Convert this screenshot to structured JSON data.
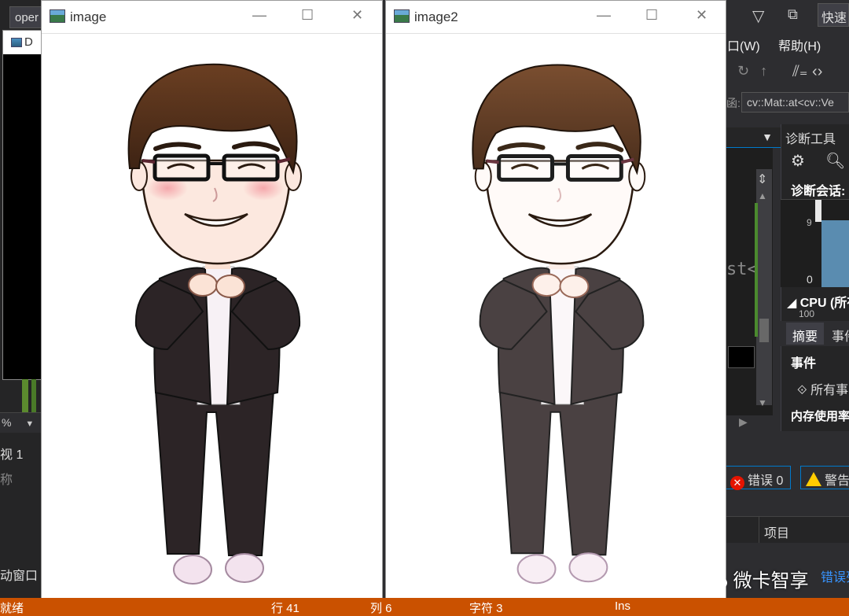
{
  "ide": {
    "console_tab": "oper",
    "console_title": "D",
    "menu_window": "口(W)",
    "menu_help": "帮助(H)",
    "quick_launch": "快速",
    "function_prefix": "函:",
    "function_combo": "cv::Mat::at<cv::Ve",
    "code_fragment": "st<",
    "zoom": "%",
    "left_panel_line1": "视 1",
    "left_panel_line2": "称",
    "left_bottom_label": "动窗口"
  },
  "diagnostics": {
    "title": "诊断工具",
    "session_label": "诊断会话:",
    "axis_top": "9",
    "axis_zero": "0",
    "cpu_label": "◢ CPU (所有",
    "axis_100": "100",
    "tab_summary": "摘要",
    "tab_events": "事件",
    "events_header": "事件",
    "all_events": "所有事",
    "memory_usage": "内存使用率"
  },
  "error_list": {
    "errors": "错误 0",
    "warnings": "警告",
    "column_project": "项目",
    "link": "错误列"
  },
  "windows": [
    {
      "title": "image"
    },
    {
      "title": "image2"
    }
  ],
  "window_buttons": {
    "minimize": "—",
    "maximize": "☐",
    "close": "✕"
  },
  "watermark": "微卡智享",
  "statusbar": {
    "ready": "就绪",
    "line": "行 41",
    "col": "列 6",
    "char": "字符 3",
    "mode": "Ins"
  },
  "colors": {
    "statusbar": "#ca5100",
    "ide_bg": "#2d2d30",
    "accent": "#007acc",
    "hair": "#4a2a17",
    "suit": "#2c2426",
    "suit_light": "#4a4142"
  }
}
